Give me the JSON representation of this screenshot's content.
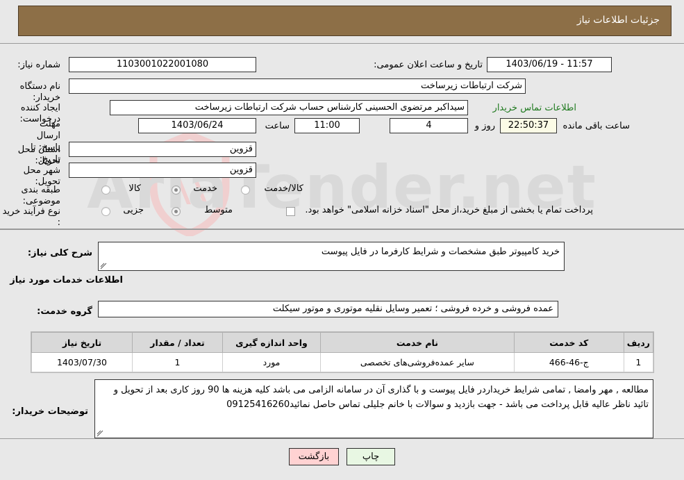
{
  "header": {
    "title": "جزئیات اطلاعات نیاز"
  },
  "watermark": {
    "text": "AriaTender.net"
  },
  "form": {
    "need_number_label": "شماره نیاز:",
    "need_number_value": "1103001022001080",
    "announce_label": "تاریخ و ساعت اعلان عمومی:",
    "announce_value": "11:57 - 1403/06/19",
    "buyer_org_label": "نام دستگاه خریدار:",
    "buyer_org_value": "شرکت ارتباطات زیرساخت",
    "requester_label": "ایجاد کننده درخواست:",
    "requester_value": "سیداکبر مرتضوی الحسینی کارشناس حساب  شرکت ارتباطات زیرساخت",
    "buyer_contact_link": "اطلاعات تماس خریدار",
    "deadline_label": "مهلت ارسال پاسخ: تا تاریخ:",
    "deadline_date": "1403/06/24",
    "deadline_hour_label": "ساعت",
    "deadline_hour_value": "11:00",
    "remain_days_value": "4",
    "remain_days_label": "روز و",
    "remain_time_value": "22:50:37",
    "remain_time_label": "ساعت باقی مانده",
    "province_label": "استان محل تحویل:",
    "province_value": "قزوین",
    "city_label": "شهر محل تحویل:",
    "city_value": "قزوین",
    "category_label": "طبقه بندی موضوعی:",
    "category_options": [
      "کالا",
      "خدمت",
      "کالا/خدمت"
    ],
    "category_selected": "خدمت",
    "process_label": "نوع فرآیند خرید :",
    "process_options": [
      "جزیی",
      "متوسط"
    ],
    "process_selected": "متوسط",
    "treasury_note": "پرداخت تمام یا بخشی از مبلغ خرید،از محل \"اسناد خزانه اسلامی\" خواهد بود."
  },
  "need_desc": {
    "label": "شرح کلی نیاز:",
    "value": "خرید  کامپیوتر طبق مشخصات و شرایط کارفرما در فایل پیوست"
  },
  "services": {
    "section_title": "اطلاعات خدمات مورد نیاز",
    "group_label": "گروه خدمت:",
    "group_value": "عمده فروشی و خرده فروشی ؛ تعمیر وسایل نقلیه موتوری و موتور سیکلت",
    "columns": [
      "ردیف",
      "کد خدمت",
      "نام خدمت",
      "واحد اندازه گیری",
      "تعداد / مقدار",
      "تاریخ نیاز"
    ],
    "rows": [
      [
        "1",
        "ج-46-466",
        "سایر عمده‌فروشی‌های تخصصی",
        "مورد",
        "1",
        "1403/07/30"
      ]
    ]
  },
  "buyer_notes": {
    "label": "توضیحات خریدار:",
    "value": "مطالعه , مهر وامضا , تمامی شرایط خریداردر فایل پیوست و با گذاری آن در سامانه الزامی می باشد کلیه هزینه ها 90 روز کاری بعد از تحویل و تائید ناظر عالیه قابل پرداخت می باشد - جهت بازدید و سوالات با خانم جلیلی تماس حاصل نمائید09125416260"
  },
  "buttons": {
    "print": "چاپ",
    "back": "بازگشت"
  }
}
